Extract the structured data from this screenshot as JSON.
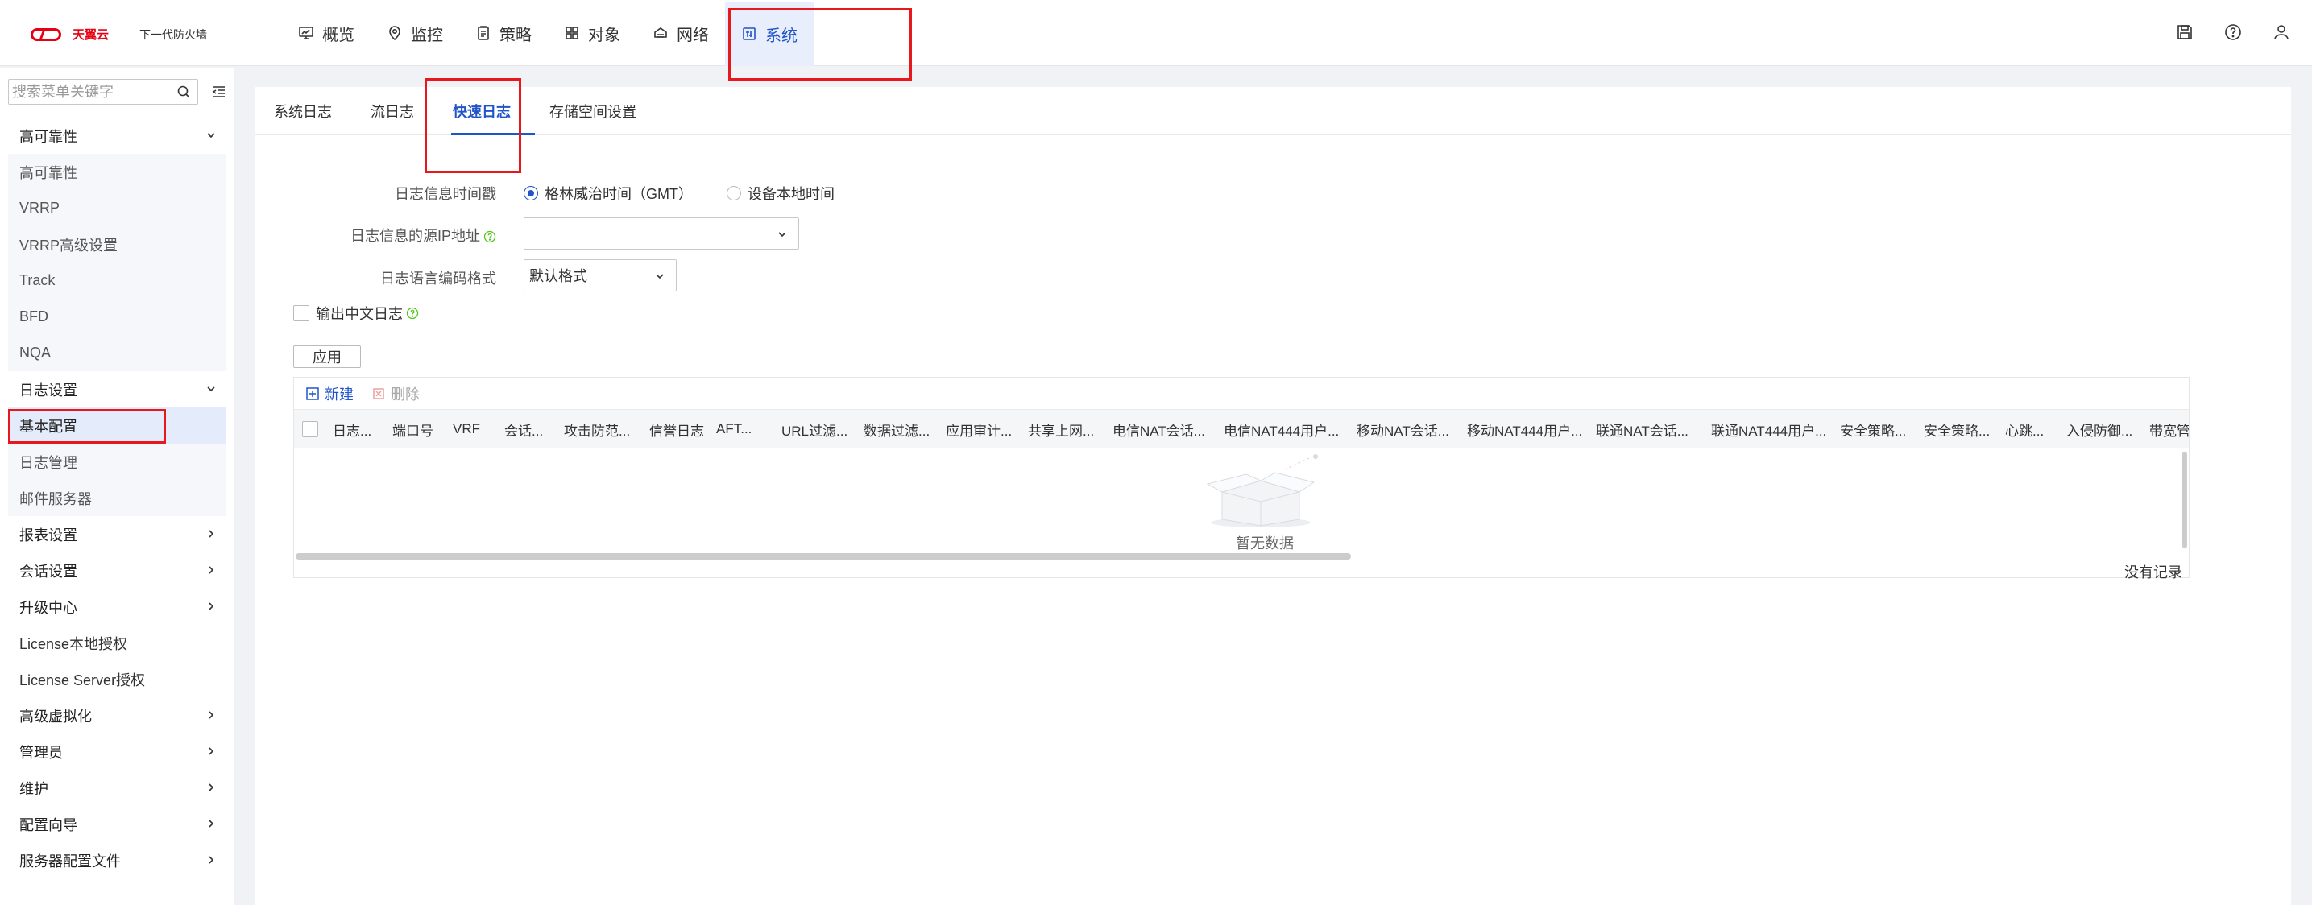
{
  "brand": {
    "logo_text": "天翼云",
    "product": "下一代防火墙"
  },
  "nav": [
    {
      "label": "概览",
      "icon": "monitor-icon"
    },
    {
      "label": "监控",
      "icon": "location-icon"
    },
    {
      "label": "策略",
      "icon": "clipboard-icon"
    },
    {
      "label": "对象",
      "icon": "grid-icon"
    },
    {
      "label": "网络",
      "icon": "network-icon"
    },
    {
      "label": "系统",
      "icon": "system-icon",
      "active": true
    }
  ],
  "top_actions": [
    "save-icon",
    "help-icon",
    "user-icon"
  ],
  "sidebar": {
    "search_placeholder": "搜索菜单关键字",
    "items": [
      {
        "label": "高可靠性",
        "type": "group",
        "expanded": true
      },
      {
        "label": "高可靠性",
        "type": "sub"
      },
      {
        "label": "VRRP",
        "type": "sub"
      },
      {
        "label": "VRRP高级设置",
        "type": "sub"
      },
      {
        "label": "Track",
        "type": "sub"
      },
      {
        "label": "BFD",
        "type": "sub"
      },
      {
        "label": "NQA",
        "type": "sub"
      },
      {
        "label": "日志设置",
        "type": "group",
        "expanded": true
      },
      {
        "label": "基本配置",
        "type": "sub",
        "selected": true
      },
      {
        "label": "日志管理",
        "type": "sub"
      },
      {
        "label": "邮件服务器",
        "type": "sub"
      },
      {
        "label": "报表设置",
        "type": "group"
      },
      {
        "label": "会话设置",
        "type": "group"
      },
      {
        "label": "升级中心",
        "type": "group"
      },
      {
        "label": "License本地授权",
        "type": "item"
      },
      {
        "label": "License Server授权",
        "type": "item"
      },
      {
        "label": "高级虚拟化",
        "type": "group"
      },
      {
        "label": "管理员",
        "type": "group"
      },
      {
        "label": "维护",
        "type": "group"
      },
      {
        "label": "配置向导",
        "type": "group"
      },
      {
        "label": "服务器配置文件",
        "type": "group"
      }
    ]
  },
  "tabs": [
    {
      "label": "系统日志"
    },
    {
      "label": "流日志"
    },
    {
      "label": "快速日志",
      "active": true
    },
    {
      "label": "存储空间设置"
    }
  ],
  "form": {
    "timestamp_label": "日志信息时间戳",
    "timestamp_options": [
      "格林威治时间（GMT）",
      "设备本地时间"
    ],
    "timestamp_selected": 0,
    "source_ip_label": "日志信息的源IP地址",
    "source_ip_value": "",
    "encoding_label": "日志语言编码格式",
    "encoding_value": "默认格式",
    "chinese_log_label": "输出中文日志",
    "chinese_log_checked": false,
    "apply_label": "应用"
  },
  "table": {
    "new_label": "新建",
    "delete_label": "删除",
    "columns": [
      "日志...",
      "端口号",
      "VRF",
      "会话...",
      "攻击防范...",
      "信誉日志",
      "AFT...",
      "URL过滤...",
      "数据过滤...",
      "应用审计...",
      "共享上网...",
      "电信NAT会话...",
      "电信NAT444用户...",
      "移动NAT会话...",
      "移动NAT444用户...",
      "联通NAT会话...",
      "联通NAT444用户...",
      "安全策略...",
      "安全策略...",
      "心跳...",
      "入侵防御...",
      "带宽管"
    ],
    "empty_text": "暂无数据",
    "no_record_text": "没有记录"
  },
  "colors": {
    "accent": "#2254c9",
    "highlight": "#e8171b",
    "help": "#52c41a"
  }
}
